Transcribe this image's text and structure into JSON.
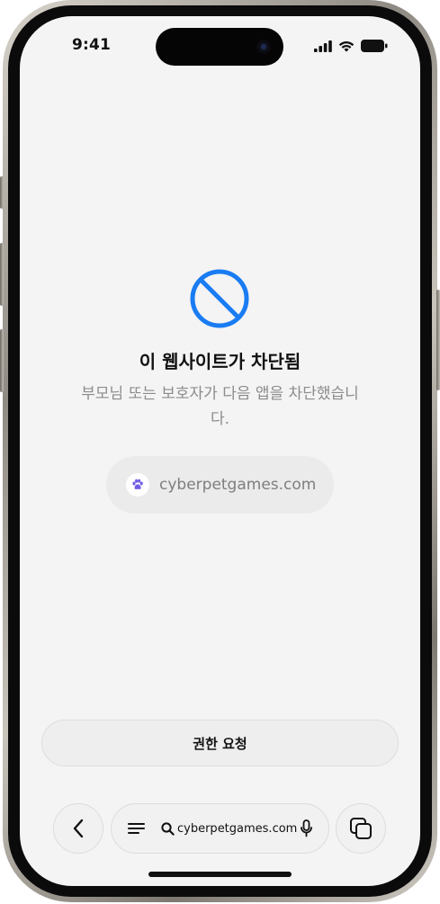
{
  "status_bar": {
    "time": "9:41",
    "icons": [
      "cellular-signal-icon",
      "wifi-icon",
      "battery-icon"
    ]
  },
  "blocked_page": {
    "icon": "prohibited-icon",
    "title": "이 웹사이트가 차단됨",
    "subtitle": "부모님 또는 보호자가 다음 앱을 차단했습니다.",
    "site_icon": "paw-icon",
    "site_url": "cyberpetgames.com",
    "request_button_label": "권한 요청"
  },
  "toolbar": {
    "back_icon": "chevron-left-icon",
    "menu_icon": "menu-lines-icon",
    "search_icon": "search-icon",
    "address": "cyberpetgames.com",
    "mic_icon": "microphone-icon",
    "tabs_icon": "tabs-icon"
  },
  "colors": {
    "accent": "#1a7cf2",
    "paw": "#6f5ce6",
    "screen_bg": "#f4f4f4",
    "secondary_text": "#8c8c8c"
  }
}
